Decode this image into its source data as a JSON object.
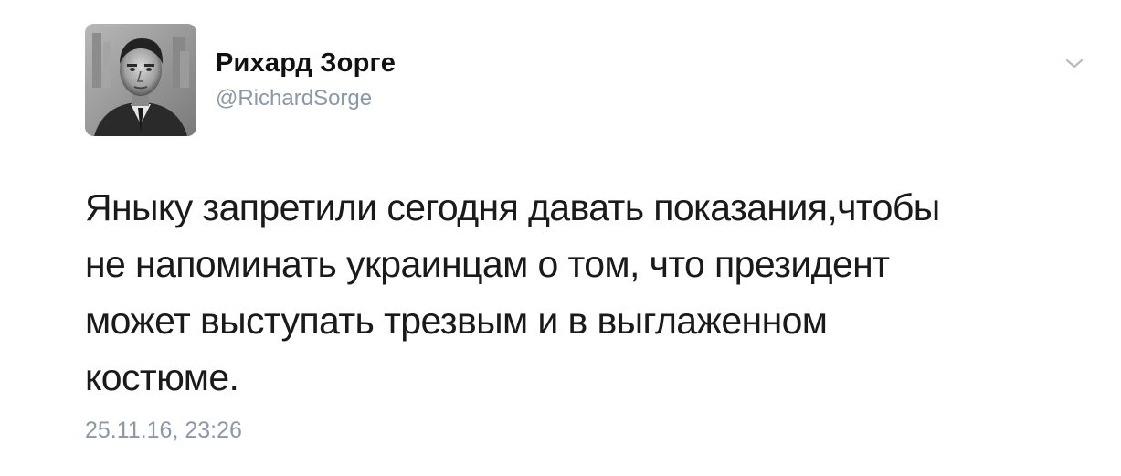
{
  "author": {
    "display_name": "Рихард Зорге",
    "handle": "@RichardSorge",
    "avatar_icon": "portrait-photo"
  },
  "menu": {
    "icon": "chevron-down-icon"
  },
  "tweet": {
    "lines": [
      "Яныку запретили сегодня давать показания,чтобы",
      "не напоминать украинцам о том, что президент",
      "может выступать трезвым и в выглаженном",
      "костюме."
    ],
    "timestamp": "25.11.16, 23:26"
  },
  "colors": {
    "text": "#1a1a1a",
    "muted": "#8b98a5",
    "background": "#ffffff"
  }
}
